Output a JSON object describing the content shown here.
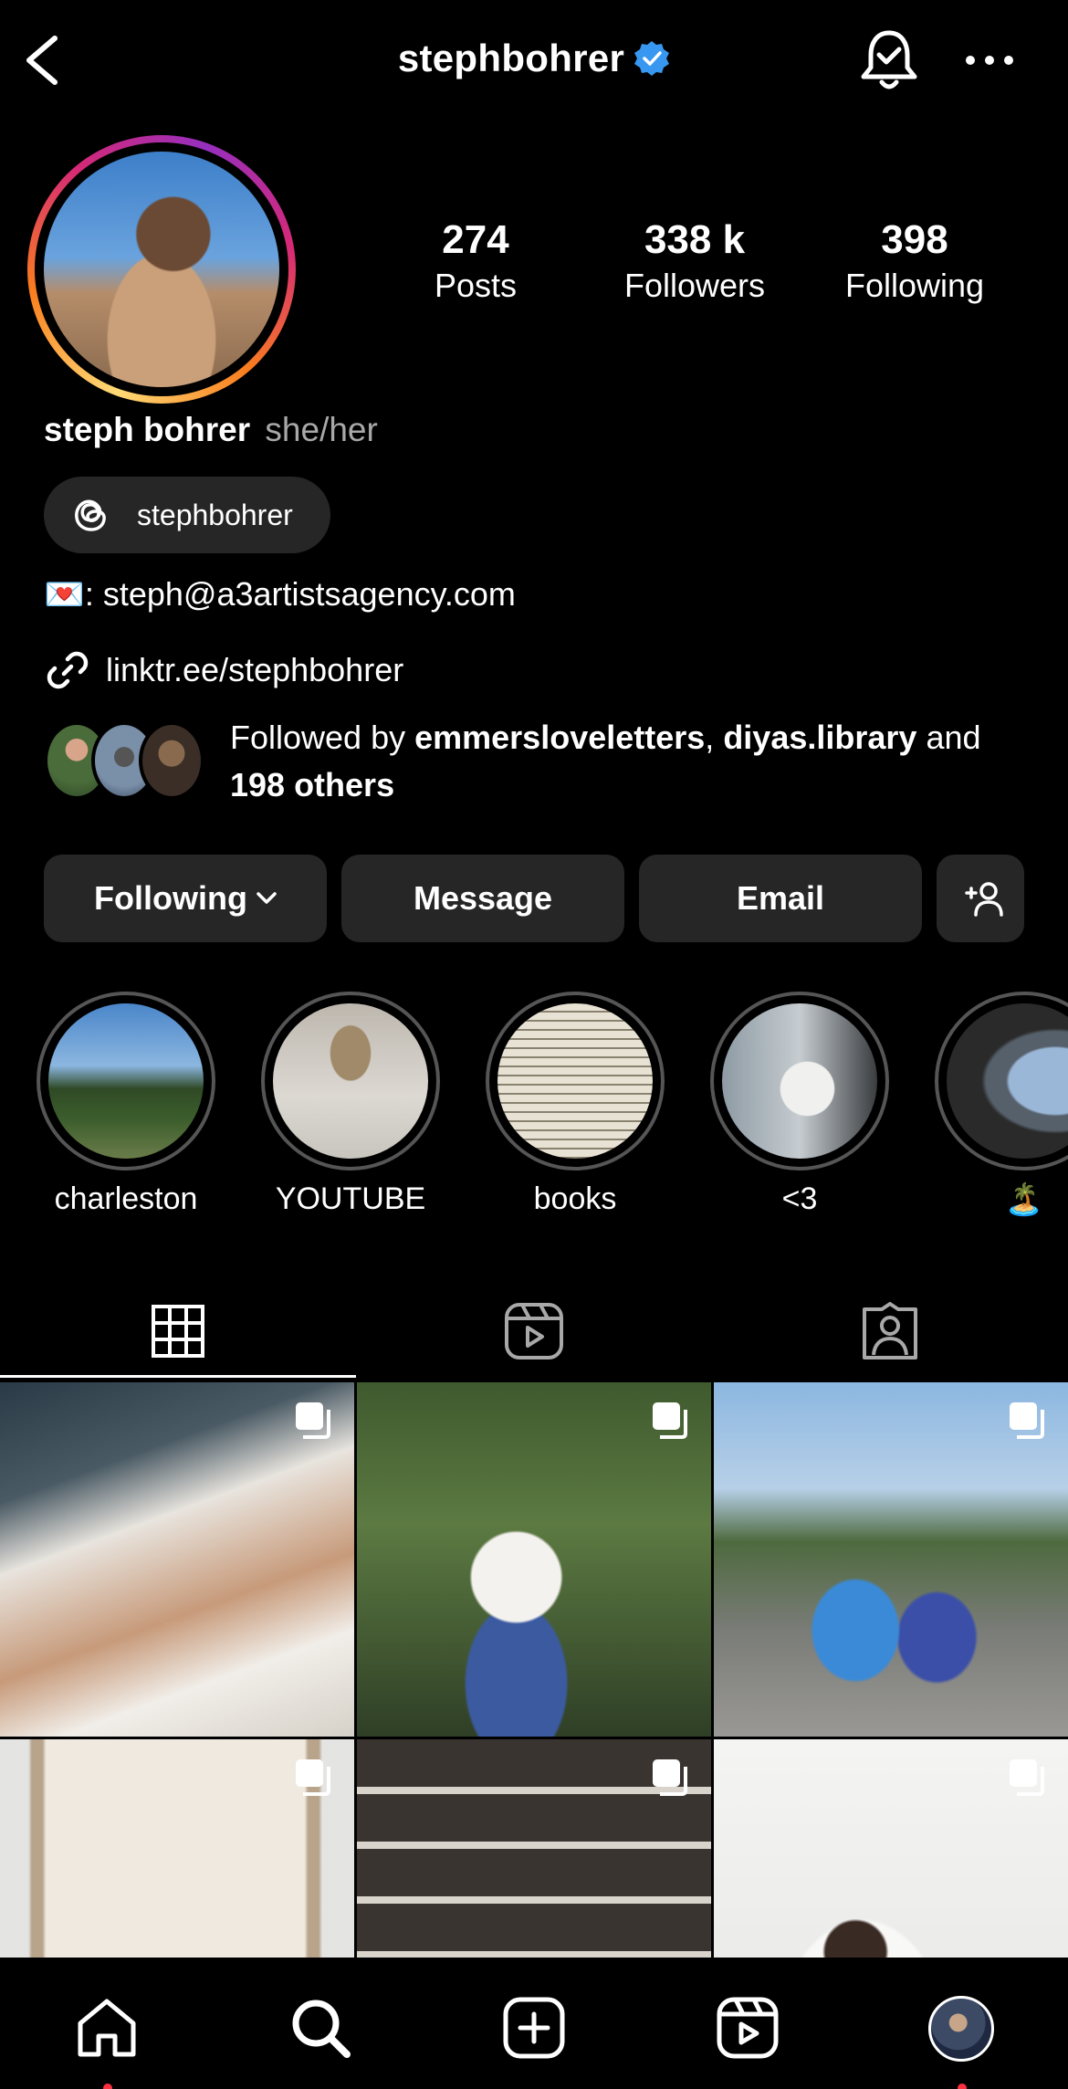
{
  "header": {
    "username": "stephbohrer"
  },
  "stats": [
    {
      "value": "274",
      "label": "Posts"
    },
    {
      "value": "338 k",
      "label": "Followers"
    },
    {
      "value": "398",
      "label": "Following"
    }
  ],
  "profile": {
    "name": "steph bohrer",
    "pronouns": "she/her",
    "threads_handle": "stephbohrer",
    "email_emoji": "💌",
    "email_text": ": steph@a3artistsagency.com",
    "link": "linktr.ee/stephbohrer",
    "followed_prefix": "Followed by ",
    "followed_user1": "emmersloveletters",
    "followed_sep": ", ",
    "followed_user2": "diyas.library",
    "followed_and": " and ",
    "followed_others": "198 others"
  },
  "buttons": {
    "following": "Following",
    "message": "Message",
    "email": "Email"
  },
  "highlights": [
    {
      "label": "charleston"
    },
    {
      "label": "YOUTUBE"
    },
    {
      "label": "books"
    },
    {
      "label": "<3"
    },
    {
      "label": "🏝️"
    }
  ],
  "colors": {
    "background": "#000000",
    "button_bg": "#262626",
    "verified": "#3897f0",
    "notification_dot": "#ff3040"
  }
}
